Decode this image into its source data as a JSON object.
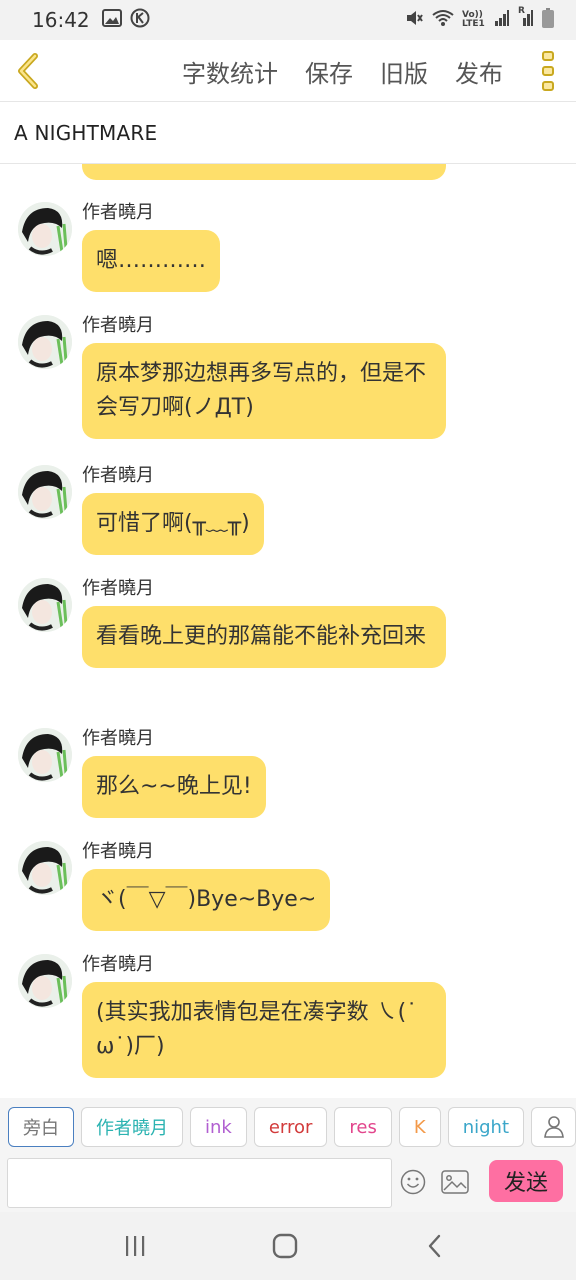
{
  "status_bar": {
    "time": "16:42",
    "icons_left": [
      "image-icon",
      "k-icon"
    ],
    "icons_right": [
      "mute-icon",
      "wifi-icon",
      "volte-icon",
      "signal-icon",
      "signal-roaming-icon",
      "battery-icon"
    ],
    "volte_text": "Vo)) LTE1",
    "roaming_text": "R"
  },
  "toolbar": {
    "back_icon": "chevron-left-icon",
    "actions": [
      "字数统计",
      "保存",
      "旧版",
      "发布"
    ],
    "more_icon": "more-vertical-icon"
  },
  "document": {
    "title": "A NIGHTMARE"
  },
  "messages": [
    {
      "sender": "作者曉月",
      "text": "嗯…………"
    },
    {
      "sender": "作者曉月",
      "text": "原本梦那边想再多写点的，但是不会写刀啊(ノДT)"
    },
    {
      "sender": "作者曉月",
      "text": "可惜了啊(╥﹏╥)"
    },
    {
      "sender": "作者曉月",
      "text": "看看晚上更的那篇能不能补充回来"
    },
    {
      "sender": "作者曉月",
      "text": "那么~~晚上见!"
    },
    {
      "sender": "作者曉月",
      "text": "ヾ(￣▽￣)Bye~Bye~"
    },
    {
      "sender": "作者曉月",
      "text": "(其实我加表情包是在凑字数 ㇏(˙ω˙)厂)"
    }
  ],
  "roles": [
    {
      "label": "旁白",
      "color": "#777777",
      "selected": true
    },
    {
      "label": "作者曉月",
      "color": "#2bb3b1",
      "selected": false
    },
    {
      "label": "ink",
      "color": "#b15fd1",
      "selected": false
    },
    {
      "label": "error",
      "color": "#d23b3b",
      "selected": false
    },
    {
      "label": "res",
      "color": "#e2458c",
      "selected": false
    },
    {
      "label": "K",
      "color": "#f39a4a",
      "selected": false
    },
    {
      "label": "night",
      "color": "#3aa6c9",
      "selected": false
    }
  ],
  "role_user_icon": "user-icon",
  "input": {
    "value": "",
    "placeholder": ""
  },
  "emoji_icon": "emoji-icon",
  "image_icon": "image-icon",
  "send_label": "发送",
  "colors": {
    "bubble": "#fedf6b",
    "send": "#fe6fa2",
    "accent": "#c9a81f"
  },
  "nav": [
    "recent-apps-icon",
    "home-icon",
    "back-icon"
  ]
}
